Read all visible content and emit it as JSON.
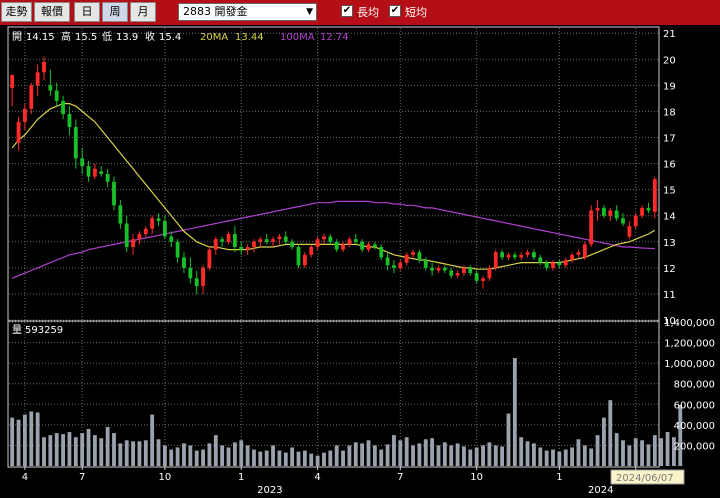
{
  "toolbar": {
    "buttons": [
      "走勢",
      "報價",
      "日",
      "周",
      "月"
    ],
    "active_button": "周",
    "stock_select": "2883 開發金",
    "long_ma_label": "長均",
    "short_ma_label": "短均",
    "long_ma_checked": true,
    "short_ma_checked": true
  },
  "info": {
    "open_label": "開",
    "open": "14.15",
    "high_label": "高",
    "high": "15.5",
    "low_label": "低",
    "low": "13.9",
    "close_label": "收",
    "close": "15.4",
    "ma20_label": "20MA",
    "ma20": "13.44",
    "ma100_label": "100MA",
    "ma100": "12.74"
  },
  "volume_info": {
    "label": "量",
    "value": "593259"
  },
  "cursor_date": "2024/06/07",
  "colors": {
    "up": "#ff2b2b",
    "down": "#19c02a",
    "ma20": "#d6d24a",
    "ma100": "#b13fcf",
    "volume": "#9aa3ad"
  },
  "chart_data": {
    "type": "candlestick",
    "price_axis": {
      "ticks": [
        10,
        11,
        12,
        13,
        14,
        15,
        16,
        17,
        18,
        19,
        20,
        21
      ],
      "range": [
        10,
        21.2
      ]
    },
    "volume_axis": {
      "ticks": [
        "200,000",
        "400,000",
        "600,000",
        "800,000",
        "1,000,000",
        "1,200,000",
        "1,400,000"
      ],
      "range": [
        0,
        1400000
      ]
    },
    "month_ticks": [
      "4",
      "7",
      "10",
      "1",
      "4",
      "7",
      "10",
      "1",
      "4"
    ],
    "month_tick_weeks": [
      2,
      11,
      24,
      36,
      48,
      61,
      73,
      86,
      98
    ],
    "year_labels": [
      "2023",
      "2024"
    ],
    "year_label_weeks": [
      40.5,
      92.5
    ],
    "ohlc": [
      [
        18.9,
        19.4,
        18.2,
        19.4
      ],
      [
        16.8,
        17.8,
        16.5,
        17.6
      ],
      [
        17.6,
        18.3,
        17.3,
        18.1
      ],
      [
        18.1,
        19.1,
        17.9,
        19.0
      ],
      [
        19.0,
        19.8,
        18.6,
        19.5
      ],
      [
        19.5,
        20.1,
        19.2,
        19.9
      ],
      [
        19.0,
        19.6,
        18.6,
        18.8
      ],
      [
        18.8,
        19.1,
        18.2,
        18.4
      ],
      [
        18.4,
        18.6,
        17.7,
        17.9
      ],
      [
        17.9,
        18.2,
        17.1,
        17.4
      ],
      [
        17.4,
        17.7,
        15.8,
        16.2
      ],
      [
        16.2,
        16.6,
        15.6,
        15.9
      ],
      [
        15.9,
        16.1,
        15.3,
        15.5
      ],
      [
        15.5,
        16.0,
        15.4,
        15.8
      ],
      [
        15.7,
        15.9,
        15.5,
        15.6
      ],
      [
        15.6,
        15.8,
        15.1,
        15.3
      ],
      [
        15.3,
        15.5,
        14.2,
        14.4
      ],
      [
        14.4,
        14.6,
        13.5,
        13.7
      ],
      [
        13.7,
        14.0,
        12.6,
        12.8
      ],
      [
        12.8,
        13.3,
        12.5,
        13.1
      ],
      [
        13.1,
        13.4,
        12.9,
        13.3
      ],
      [
        13.3,
        13.6,
        13.2,
        13.5
      ],
      [
        13.5,
        14.0,
        13.3,
        13.9
      ],
      [
        13.9,
        14.1,
        13.6,
        13.8
      ],
      [
        13.8,
        14.0,
        13.1,
        13.2
      ],
      [
        13.2,
        13.4,
        12.8,
        13.0
      ],
      [
        13.0,
        13.1,
        12.2,
        12.4
      ],
      [
        12.4,
        12.6,
        11.8,
        12.0
      ],
      [
        12.0,
        12.4,
        11.4,
        11.6
      ],
      [
        11.6,
        11.9,
        11.0,
        11.3
      ],
      [
        11.3,
        12.1,
        11.0,
        12.0
      ],
      [
        12.0,
        12.8,
        11.9,
        12.7
      ],
      [
        12.7,
        13.2,
        12.5,
        13.1
      ],
      [
        13.1,
        13.2,
        12.8,
        13.0
      ],
      [
        13.0,
        13.4,
        12.9,
        13.3
      ],
      [
        13.3,
        13.6,
        12.6,
        12.8
      ],
      [
        12.8,
        13.0,
        12.5,
        12.7
      ],
      [
        12.7,
        12.9,
        12.5,
        12.8
      ],
      [
        12.8,
        13.1,
        12.6,
        13.0
      ],
      [
        13.0,
        13.2,
        12.8,
        13.1
      ],
      [
        13.1,
        13.3,
        12.9,
        13.0
      ],
      [
        13.0,
        13.2,
        12.8,
        13.1
      ],
      [
        13.1,
        13.3,
        12.9,
        13.2
      ],
      [
        13.2,
        13.4,
        12.9,
        13.0
      ],
      [
        13.0,
        13.1,
        12.7,
        12.8
      ],
      [
        12.8,
        12.9,
        12.0,
        12.1
      ],
      [
        12.1,
        12.6,
        12.0,
        12.5
      ],
      [
        12.5,
        12.9,
        12.4,
        12.8
      ],
      [
        12.8,
        13.2,
        12.7,
        13.1
      ],
      [
        13.1,
        13.3,
        12.9,
        13.2
      ],
      [
        13.2,
        13.3,
        12.9,
        13.0
      ],
      [
        13.0,
        13.1,
        12.6,
        12.7
      ],
      [
        12.7,
        13.0,
        12.6,
        12.9
      ],
      [
        12.9,
        13.2,
        12.8,
        13.1
      ],
      [
        13.1,
        13.3,
        12.9,
        13.0
      ],
      [
        13.0,
        13.1,
        12.6,
        12.7
      ],
      [
        12.7,
        13.0,
        12.6,
        12.9
      ],
      [
        12.9,
        13.0,
        12.7,
        12.8
      ],
      [
        12.8,
        12.9,
        12.3,
        12.4
      ],
      [
        12.4,
        12.6,
        11.9,
        12.1
      ],
      [
        12.1,
        12.3,
        11.8,
        12.0
      ],
      [
        12.0,
        12.3,
        11.9,
        12.2
      ],
      [
        12.2,
        12.6,
        12.1,
        12.5
      ],
      [
        12.5,
        12.7,
        12.4,
        12.6
      ],
      [
        12.6,
        12.7,
        12.2,
        12.3
      ],
      [
        12.3,
        12.4,
        11.9,
        12.0
      ],
      [
        12.0,
        12.2,
        11.7,
        11.9
      ],
      [
        11.9,
        12.1,
        11.8,
        12.0
      ],
      [
        12.0,
        12.1,
        11.8,
        11.9
      ],
      [
        11.9,
        12.0,
        11.6,
        11.7
      ],
      [
        11.7,
        11.9,
        11.6,
        11.8
      ],
      [
        11.8,
        12.1,
        11.7,
        12.0
      ],
      [
        12.0,
        12.1,
        11.7,
        11.8
      ],
      [
        11.8,
        11.9,
        11.4,
        11.5
      ],
      [
        11.5,
        11.7,
        11.2,
        11.6
      ],
      [
        11.6,
        12.1,
        11.5,
        12.0
      ],
      [
        12.0,
        12.7,
        11.9,
        12.6
      ],
      [
        12.6,
        12.7,
        12.3,
        12.4
      ],
      [
        12.4,
        12.6,
        12.3,
        12.5
      ],
      [
        12.5,
        12.6,
        12.3,
        12.4
      ],
      [
        12.4,
        12.6,
        12.3,
        12.5
      ],
      [
        12.5,
        12.7,
        12.4,
        12.6
      ],
      [
        12.6,
        12.7,
        12.3,
        12.4
      ],
      [
        12.4,
        12.5,
        12.1,
        12.2
      ],
      [
        12.2,
        12.3,
        11.9,
        12.0
      ],
      [
        12.0,
        12.3,
        11.9,
        12.2
      ],
      [
        12.2,
        12.3,
        12.0,
        12.1
      ],
      [
        12.1,
        12.4,
        12.0,
        12.3
      ],
      [
        12.3,
        12.6,
        12.2,
        12.5
      ],
      [
        12.5,
        12.7,
        12.4,
        12.6
      ],
      [
        12.4,
        13.0,
        12.3,
        12.9
      ],
      [
        12.9,
        14.4,
        12.8,
        14.2
      ],
      [
        14.2,
        14.6,
        13.8,
        14.3
      ],
      [
        14.3,
        14.4,
        13.9,
        14.0
      ],
      [
        14.0,
        14.3,
        13.8,
        14.2
      ],
      [
        14.2,
        14.4,
        13.8,
        13.9
      ],
      [
        13.9,
        14.1,
        13.6,
        13.7
      ],
      [
        13.2,
        13.8,
        13.1,
        13.6
      ],
      [
        13.6,
        14.1,
        13.5,
        14.0
      ],
      [
        14.0,
        14.4,
        13.9,
        14.3
      ],
      [
        14.3,
        14.5,
        14.1,
        14.2
      ],
      [
        14.15,
        15.5,
        13.9,
        15.4
      ]
    ],
    "ma20": [
      16.6,
      16.9,
      17.1,
      17.4,
      17.7,
      17.9,
      18.1,
      18.2,
      18.3,
      18.3,
      18.2,
      18.0,
      17.8,
      17.6,
      17.3,
      17.0,
      16.7,
      16.4,
      16.1,
      15.8,
      15.5,
      15.2,
      14.9,
      14.6,
      14.3,
      14.0,
      13.7,
      13.4,
      13.2,
      13.0,
      12.9,
      12.8,
      12.8,
      12.75,
      12.7,
      12.7,
      12.7,
      12.7,
      12.75,
      12.8,
      12.8,
      12.8,
      12.85,
      12.9,
      12.9,
      12.9,
      12.9,
      12.9,
      12.9,
      12.9,
      12.9,
      12.9,
      12.9,
      12.9,
      12.9,
      12.85,
      12.8,
      12.8,
      12.7,
      12.6,
      12.5,
      12.45,
      12.4,
      12.35,
      12.3,
      12.3,
      12.25,
      12.2,
      12.15,
      12.1,
      12.05,
      12.0,
      12.0,
      11.95,
      11.95,
      11.95,
      12.0,
      12.05,
      12.1,
      12.15,
      12.2,
      12.2,
      12.2,
      12.2,
      12.2,
      12.2,
      12.2,
      12.25,
      12.3,
      12.35,
      12.4,
      12.5,
      12.6,
      12.7,
      12.8,
      12.9,
      12.95,
      13.0,
      13.1,
      13.2,
      13.3,
      13.44
    ],
    "ma100": [
      11.6,
      11.7,
      11.8,
      11.9,
      12.0,
      12.1,
      12.2,
      12.3,
      12.4,
      12.5,
      12.55,
      12.6,
      12.7,
      12.75,
      12.8,
      12.85,
      12.9,
      12.95,
      13.0,
      13.05,
      13.1,
      13.15,
      13.2,
      13.25,
      13.3,
      13.35,
      13.4,
      13.45,
      13.5,
      13.55,
      13.6,
      13.65,
      13.7,
      13.75,
      13.8,
      13.85,
      13.9,
      13.95,
      14.0,
      14.05,
      14.1,
      14.15,
      14.2,
      14.25,
      14.3,
      14.35,
      14.4,
      14.45,
      14.5,
      14.5,
      14.5,
      14.55,
      14.55,
      14.55,
      14.55,
      14.55,
      14.55,
      14.5,
      14.5,
      14.5,
      14.45,
      14.45,
      14.4,
      14.4,
      14.35,
      14.3,
      14.3,
      14.25,
      14.2,
      14.15,
      14.1,
      14.05,
      14.0,
      13.95,
      13.9,
      13.85,
      13.8,
      13.75,
      13.7,
      13.65,
      13.6,
      13.55,
      13.5,
      13.45,
      13.4,
      13.35,
      13.3,
      13.25,
      13.2,
      13.15,
      13.1,
      13.05,
      13.0,
      12.95,
      12.9,
      12.85,
      12.8,
      12.8,
      12.78,
      12.76,
      12.75,
      12.74
    ],
    "volume": [
      470000,
      450000,
      500000,
      530000,
      520000,
      280000,
      300000,
      320000,
      310000,
      330000,
      280000,
      320000,
      360000,
      300000,
      270000,
      380000,
      320000,
      220000,
      250000,
      240000,
      240000,
      250000,
      500000,
      260000,
      200000,
      160000,
      180000,
      220000,
      200000,
      150000,
      160000,
      220000,
      300000,
      200000,
      180000,
      230000,
      250000,
      200000,
      160000,
      140000,
      150000,
      200000,
      150000,
      130000,
      180000,
      140000,
      150000,
      120000,
      100000,
      130000,
      150000,
      200000,
      150000,
      200000,
      230000,
      220000,
      250000,
      200000,
      160000,
      210000,
      300000,
      250000,
      280000,
      200000,
      220000,
      260000,
      270000,
      200000,
      230000,
      200000,
      220000,
      190000,
      160000,
      180000,
      200000,
      230000,
      200000,
      190000,
      510000,
      1050000,
      280000,
      240000,
      220000,
      180000,
      150000,
      160000,
      140000,
      160000,
      180000,
      260000,
      200000,
      170000,
      300000,
      470000,
      640000,
      320000,
      250000,
      200000,
      270000,
      250000,
      210000,
      300000,
      270000,
      330000,
      280000,
      593259
    ]
  }
}
